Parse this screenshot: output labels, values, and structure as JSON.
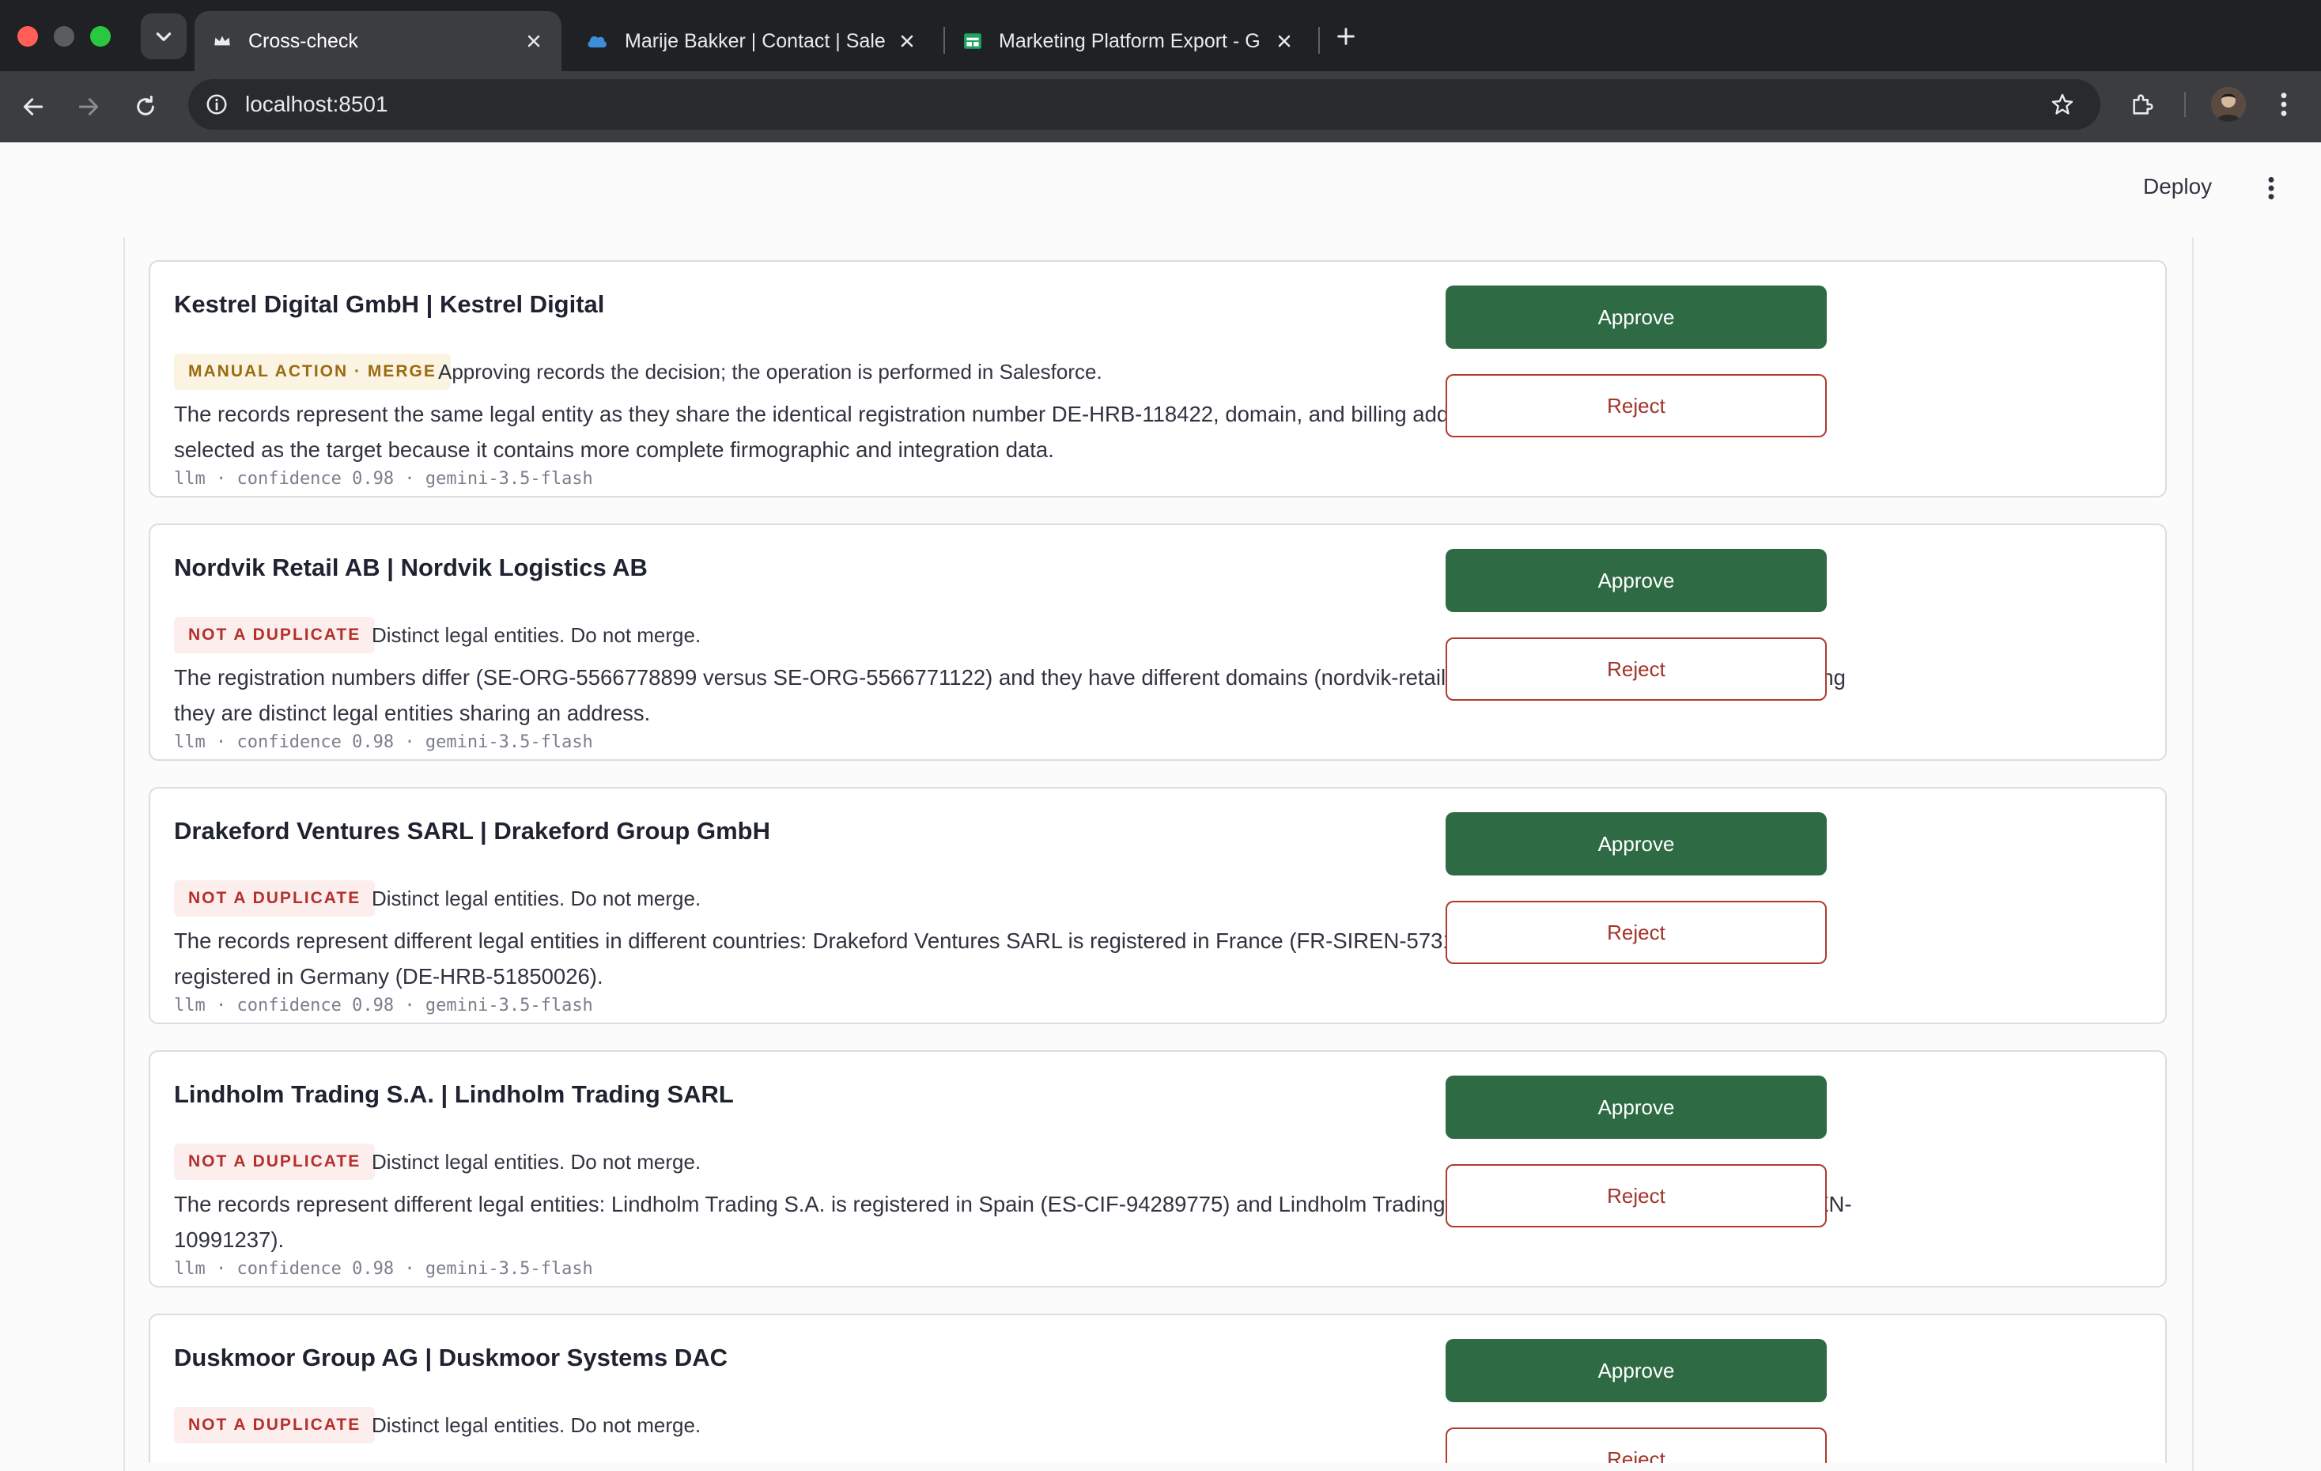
{
  "browser": {
    "tabs": [
      {
        "title": "Cross-check",
        "active": true,
        "favicon": "crown-icon"
      },
      {
        "title": "Marije Bakker | Contact | Sale",
        "active": false,
        "favicon": "cloud-icon"
      },
      {
        "title": "Marketing Platform Export - G",
        "active": false,
        "favicon": "sheets-icon"
      }
    ],
    "address": "localhost:8501"
  },
  "app": {
    "deploy_label": "Deploy"
  },
  "labels": {
    "approve": "Approve",
    "reject": "Reject"
  },
  "colors": {
    "approve_bg": "#2e6b45",
    "reject_text": "#a3342c",
    "merge_badge_text": "#9a6b10",
    "not_duplicate_badge_text": "#b3302b"
  },
  "cards": [
    {
      "title": "Kestrel Digital GmbH | Kestrel Digital",
      "badge": "MANUAL ACTION · MERGE",
      "badge_type": "merge",
      "note": "Approving records the decision; the operation is performed in Salesforce.",
      "reason": "The records represent the same legal entity as they share the identical registration number DE-HRB-118422, domain, and billing address. Record 001aj00003M333FAAR is selected as the target because it contains more complete firmographic and integration data.",
      "meta": "llm · confidence 0.98 · gemini-3.5-flash"
    },
    {
      "title": "Nordvik Retail AB | Nordvik Logistics AB",
      "badge": "NOT A DUPLICATE",
      "badge_type": "notdup",
      "note": "Distinct legal entities. Do not merge.",
      "reason": "The registration numbers differ (SE-ORG-5566778899 versus SE-ORG-5566771122) and they have different domains (nordvik-retail.se versus nordvik-logistics.se), indicating they are distinct legal entities sharing an address.",
      "meta": "llm · confidence 0.98 · gemini-3.5-flash"
    },
    {
      "title": "Drakeford Ventures SARL | Drakeford Group GmbH",
      "badge": "NOT A DUPLICATE",
      "badge_type": "notdup",
      "note": "Distinct legal entities. Do not merge.",
      "reason": "The records represent different legal entities in different countries: Drakeford Ventures SARL is registered in France (FR-SIREN-57310494) and Drakeford Group GmbH is registered in Germany (DE-HRB-51850026).",
      "meta": "llm · confidence 0.98 · gemini-3.5-flash"
    },
    {
      "title": "Lindholm Trading S.A. | Lindholm Trading SARL",
      "badge": "NOT A DUPLICATE",
      "badge_type": "notdup",
      "note": "Distinct legal entities. Do not merge.",
      "reason": "The records represent different legal entities: Lindholm Trading S.A. is registered in Spain (ES-CIF-94289775) and Lindholm Trading SARL is registered in France (FR-SIREN-10991237).",
      "meta": "llm · confidence 0.98 · gemini-3.5-flash"
    },
    {
      "title": "Duskmoor Group AG | Duskmoor Systems DAC",
      "badge": "NOT A DUPLICATE",
      "badge_type": "notdup",
      "note": "Distinct legal entities. Do not merge.",
      "reason": "",
      "meta": ""
    }
  ]
}
